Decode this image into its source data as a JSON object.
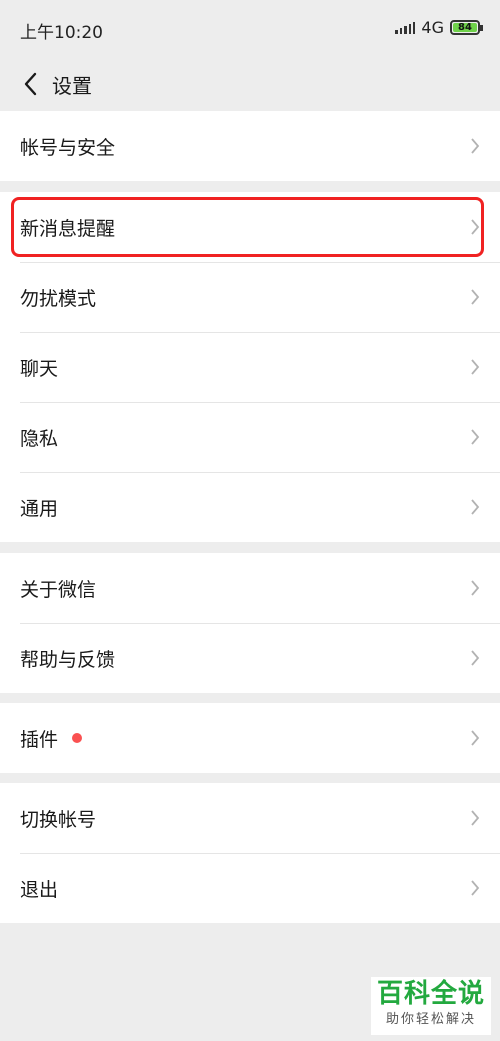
{
  "status_bar": {
    "time": "上午10:20",
    "network": "4G",
    "battery": "84",
    "battery_color": "#6fd14a"
  },
  "nav": {
    "back_icon": "chevron-left-icon",
    "title": "设置"
  },
  "groups": [
    {
      "items": [
        {
          "label": "帐号与安全"
        }
      ]
    },
    {
      "items": [
        {
          "label": "新消息提醒",
          "highlighted": true
        },
        {
          "label": "勿扰模式"
        },
        {
          "label": "聊天"
        },
        {
          "label": "隐私"
        },
        {
          "label": "通用"
        }
      ]
    },
    {
      "items": [
        {
          "label": "关于微信"
        },
        {
          "label": "帮助与反馈"
        }
      ]
    },
    {
      "items": [
        {
          "label": "插件",
          "badge": "red-dot"
        }
      ]
    },
    {
      "items": [
        {
          "label": "切换帐号"
        },
        {
          "label": "退出"
        }
      ]
    }
  ],
  "colors": {
    "background": "#ededed",
    "highlight": "#f02222",
    "badge": "#fa5151"
  },
  "watermark": {
    "title": "百科全说",
    "subtitle": "助你轻松解决"
  }
}
